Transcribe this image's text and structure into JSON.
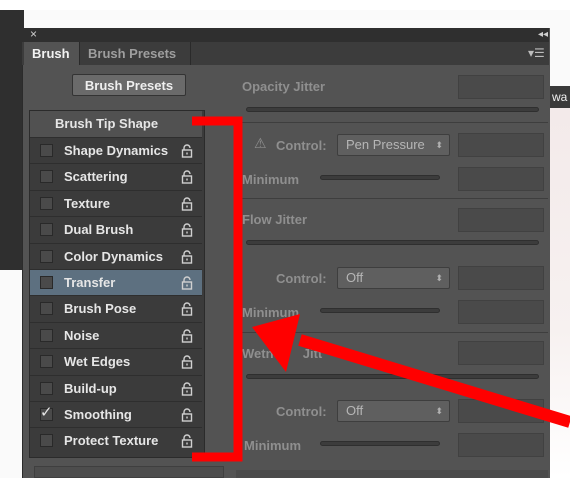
{
  "panel": {
    "tabs": [
      "Brush",
      "Brush Presets"
    ],
    "presets_button": "Brush Presets",
    "close_glyph": "×",
    "collapse_glyph": "◂◂",
    "menu_glyph": "▾☰",
    "background_right_text": "wa"
  },
  "list": {
    "header": "Brush Tip Shape",
    "items": [
      {
        "label": "Shape Dynamics",
        "checked": false
      },
      {
        "label": "Scattering",
        "checked": false
      },
      {
        "label": "Texture",
        "checked": false
      },
      {
        "label": "Dual Brush",
        "checked": false
      },
      {
        "label": "Color Dynamics",
        "checked": false
      },
      {
        "label": "Transfer",
        "checked": false,
        "selected": true
      },
      {
        "label": "Brush Pose",
        "checked": false
      },
      {
        "label": "Noise",
        "checked": false
      },
      {
        "label": "Wet Edges",
        "checked": false
      },
      {
        "label": "Build-up",
        "checked": false
      },
      {
        "label": "Smoothing",
        "checked": true
      },
      {
        "label": "Protect Texture",
        "checked": false
      }
    ],
    "checkmark": "✓"
  },
  "settings": {
    "opacity_jitter": "Opacity Jitter",
    "control_label": "Control:",
    "control_pen_pressure": "Pen Pressure",
    "minimum": "Minimum",
    "flow_jitter": "Flow Jitter",
    "control_off_1": "Off",
    "wetness_jitter_partial": "Wetne",
    "wetness_jitter_tail": "Jitt",
    "control_off_2": "Off",
    "warning_glyph": "⚠",
    "dropdown_arrow": "⬍"
  },
  "colors": {
    "panel_bg": "#535353",
    "list_bg": "#3b3b3b",
    "selected_row": "#5d7080",
    "annotation_red": "#ff0000"
  }
}
